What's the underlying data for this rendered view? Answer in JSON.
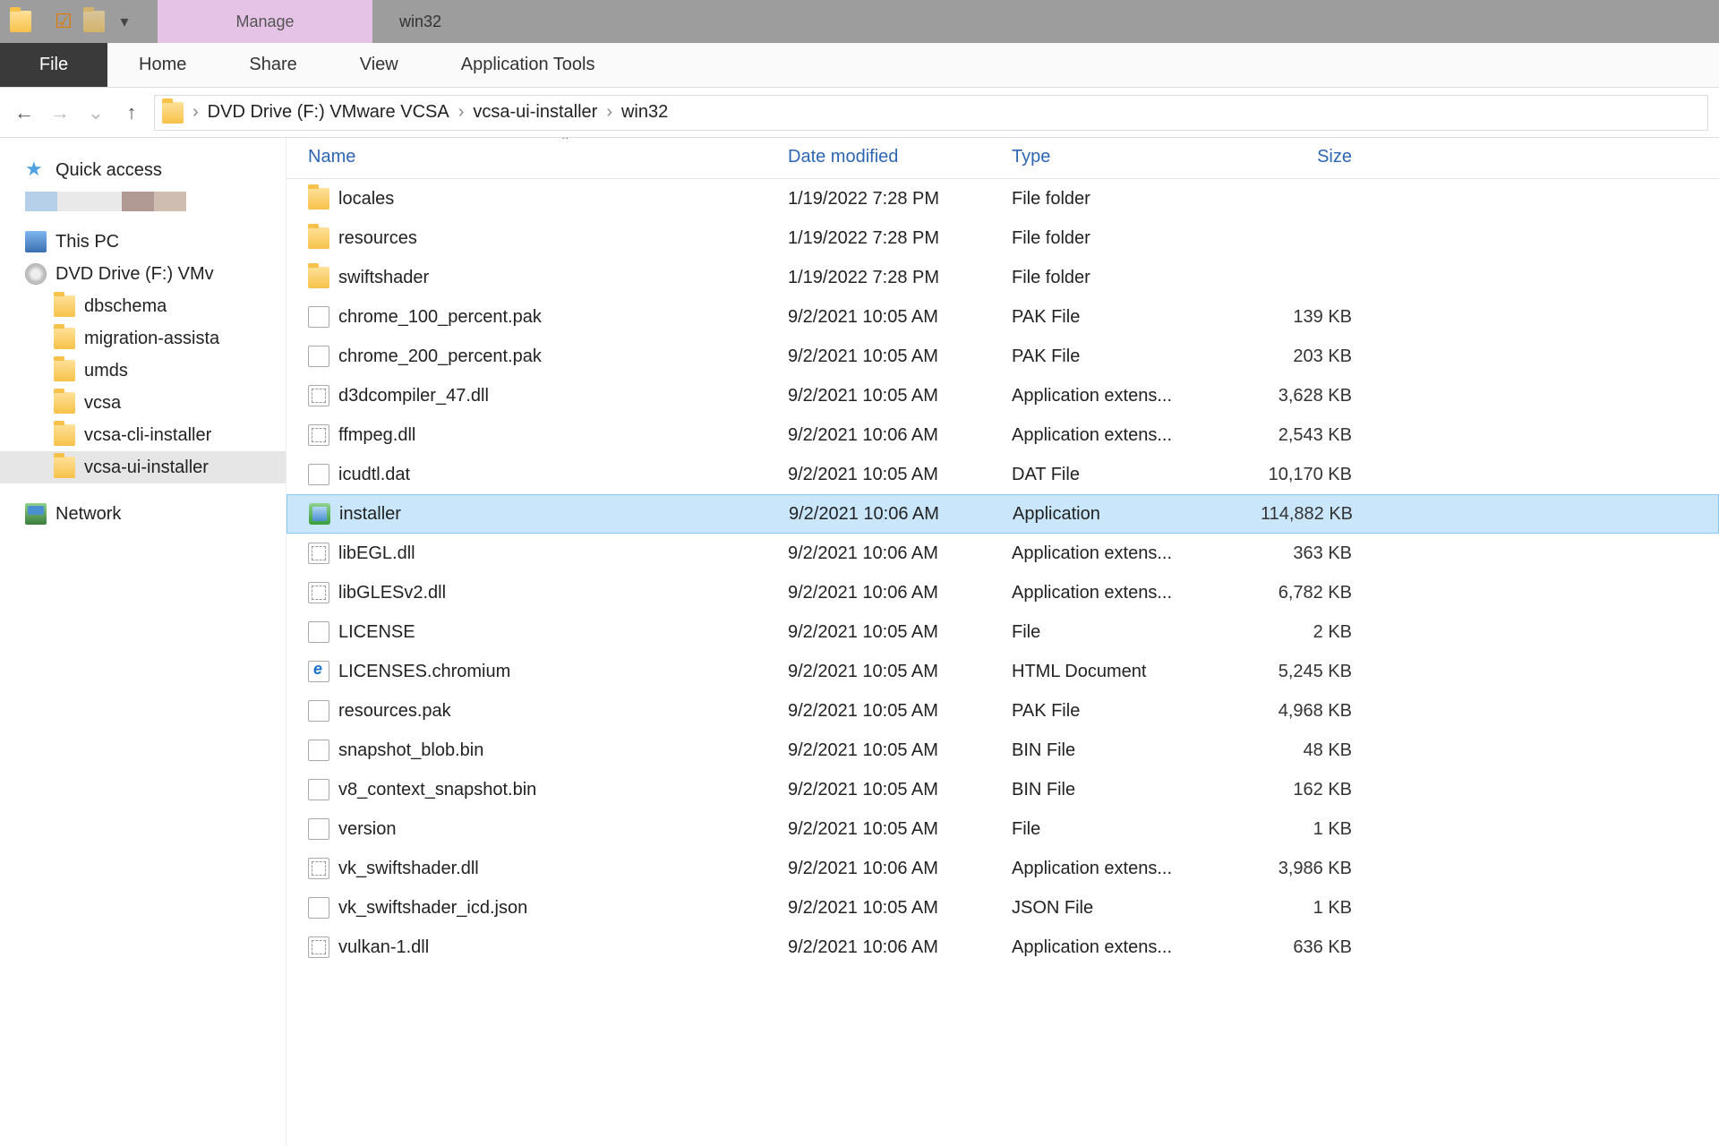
{
  "titlebar": {
    "manage_label": "Manage",
    "window_title": "win32"
  },
  "ribbon": {
    "file": "File",
    "tabs": [
      "Home",
      "Share",
      "View",
      "Application Tools"
    ]
  },
  "breadcrumb": {
    "root": "DVD Drive (F:) VMware VCSA",
    "mid": "vcsa-ui-installer",
    "leaf": "win32"
  },
  "sidebar": {
    "quick_access": "Quick access",
    "this_pc": "This PC",
    "dvd": "DVD Drive (F:) VMv",
    "network": "Network",
    "folders": [
      "dbschema",
      "migration-assista",
      "umds",
      "vcsa",
      "vcsa-cli-installer",
      "vcsa-ui-installer"
    ]
  },
  "badge_colors": [
    "#b7d0ea",
    "#e9e9e9",
    "#e9e9e9",
    "#b19a93",
    "#cfbdb1"
  ],
  "columns": {
    "name": "Name",
    "date": "Date modified",
    "type": "Type",
    "size": "Size"
  },
  "files": [
    {
      "icon": "folder",
      "name": "locales",
      "date": "1/19/2022 7:28 PM",
      "type": "File folder",
      "size": ""
    },
    {
      "icon": "folder",
      "name": "resources",
      "date": "1/19/2022 7:28 PM",
      "type": "File folder",
      "size": ""
    },
    {
      "icon": "folder",
      "name": "swiftshader",
      "date": "1/19/2022 7:28 PM",
      "type": "File folder",
      "size": ""
    },
    {
      "icon": "file",
      "name": "chrome_100_percent.pak",
      "date": "9/2/2021 10:05 AM",
      "type": "PAK File",
      "size": "139 KB"
    },
    {
      "icon": "file",
      "name": "chrome_200_percent.pak",
      "date": "9/2/2021 10:05 AM",
      "type": "PAK File",
      "size": "203 KB"
    },
    {
      "icon": "dll",
      "name": "d3dcompiler_47.dll",
      "date": "9/2/2021 10:05 AM",
      "type": "Application extens...",
      "size": "3,628 KB"
    },
    {
      "icon": "dll",
      "name": "ffmpeg.dll",
      "date": "9/2/2021 10:06 AM",
      "type": "Application extens...",
      "size": "2,543 KB"
    },
    {
      "icon": "file",
      "name": "icudtl.dat",
      "date": "9/2/2021 10:05 AM",
      "type": "DAT File",
      "size": "10,170 KB"
    },
    {
      "icon": "exe",
      "name": "installer",
      "date": "9/2/2021 10:06 AM",
      "type": "Application",
      "size": "114,882 KB",
      "selected": true
    },
    {
      "icon": "dll",
      "name": "libEGL.dll",
      "date": "9/2/2021 10:06 AM",
      "type": "Application extens...",
      "size": "363 KB"
    },
    {
      "icon": "dll",
      "name": "libGLESv2.dll",
      "date": "9/2/2021 10:06 AM",
      "type": "Application extens...",
      "size": "6,782 KB"
    },
    {
      "icon": "file",
      "name": "LICENSE",
      "date": "9/2/2021 10:05 AM",
      "type": "File",
      "size": "2 KB"
    },
    {
      "icon": "ie",
      "name": "LICENSES.chromium",
      "date": "9/2/2021 10:05 AM",
      "type": "HTML Document",
      "size": "5,245 KB"
    },
    {
      "icon": "file",
      "name": "resources.pak",
      "date": "9/2/2021 10:05 AM",
      "type": "PAK File",
      "size": "4,968 KB"
    },
    {
      "icon": "file",
      "name": "snapshot_blob.bin",
      "date": "9/2/2021 10:05 AM",
      "type": "BIN File",
      "size": "48 KB"
    },
    {
      "icon": "file",
      "name": "v8_context_snapshot.bin",
      "date": "9/2/2021 10:05 AM",
      "type": "BIN File",
      "size": "162 KB"
    },
    {
      "icon": "file",
      "name": "version",
      "date": "9/2/2021 10:05 AM",
      "type": "File",
      "size": "1 KB"
    },
    {
      "icon": "dll",
      "name": "vk_swiftshader.dll",
      "date": "9/2/2021 10:06 AM",
      "type": "Application extens...",
      "size": "3,986 KB"
    },
    {
      "icon": "file",
      "name": "vk_swiftshader_icd.json",
      "date": "9/2/2021 10:05 AM",
      "type": "JSON File",
      "size": "1 KB"
    },
    {
      "icon": "dll",
      "name": "vulkan-1.dll",
      "date": "9/2/2021 10:06 AM",
      "type": "Application extens...",
      "size": "636 KB"
    }
  ]
}
